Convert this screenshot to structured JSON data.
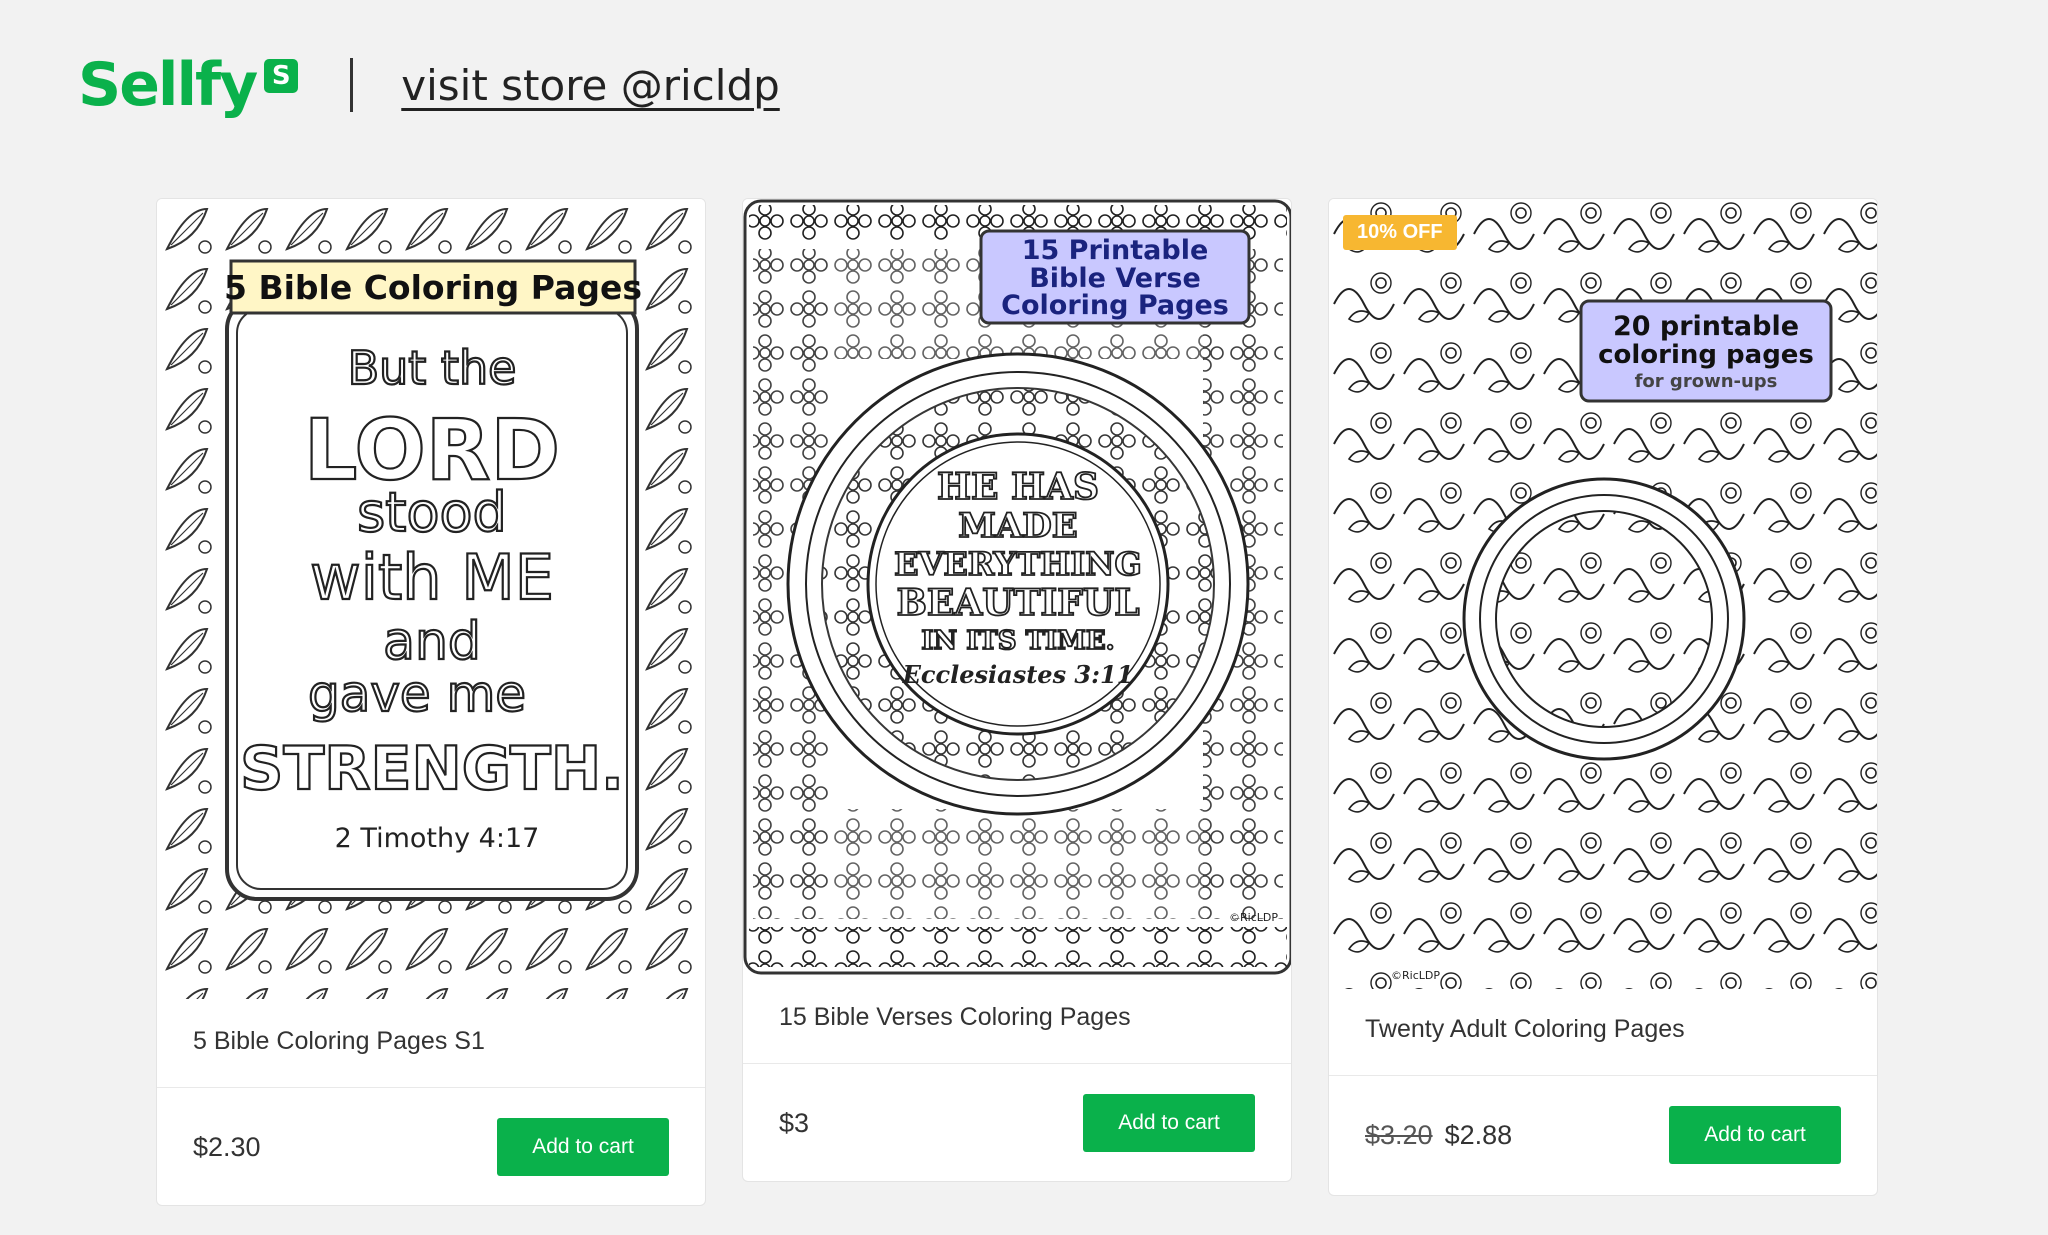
{
  "header": {
    "brand": "Sellfy",
    "brand_badge": "S",
    "visit_link": "visit store @ricldp"
  },
  "products": [
    {
      "image_label": "5 Bible Coloring Pages",
      "image_text_lines": [
        "But the",
        "LORD",
        "stood",
        "with ME",
        "and",
        "gave me",
        "STRENGTH.",
        "2 Timothy 4:17"
      ],
      "title": "5 Bible Coloring Pages S1",
      "price": "$2.30",
      "button": "Add to cart"
    },
    {
      "image_label_lines": [
        "15 Printable",
        "Bible Verse",
        "Coloring Pages"
      ],
      "image_text_lines": [
        "HE HAS",
        "MADE",
        "EVERYTHING",
        "BEAUTIFUL",
        "IN ITS TIME.",
        "Ecclesiastes 3:11"
      ],
      "image_credit": "©RicLDP",
      "title": "15 Bible Verses Coloring Pages",
      "price": "$3",
      "button": "Add to cart"
    },
    {
      "badge": "10% OFF",
      "image_label_lines": [
        "20 printable",
        "coloring pages",
        "for grown-ups"
      ],
      "image_credit": "©RicLDP",
      "title": "Twenty Adult Coloring Pages",
      "old_price": "$3.20",
      "price": "$2.88",
      "button": "Add to cart"
    }
  ],
  "colors": {
    "brand_green": "#0ab14b",
    "badge_orange": "#f7b731",
    "label_yellow": "#fff6c6",
    "label_purple": "#c9c8ff"
  }
}
